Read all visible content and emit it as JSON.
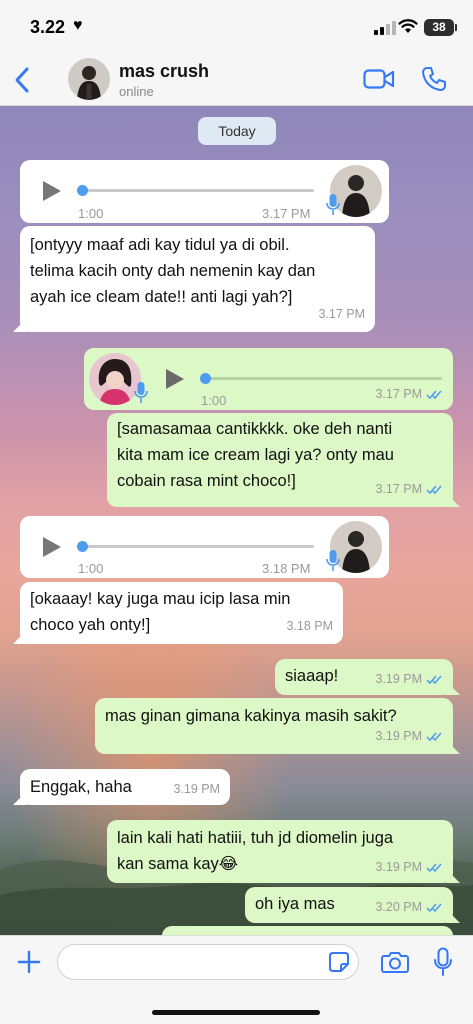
{
  "status_bar": {
    "time": "3.22",
    "battery": "38"
  },
  "header": {
    "contact_name": "mas crush",
    "contact_status": "online"
  },
  "chat": {
    "date_label": "Today",
    "messages": [
      {
        "type": "voice",
        "direction": "in",
        "duration": "1:00",
        "time": "3.17 PM"
      },
      {
        "type": "text",
        "direction": "in",
        "lines": [
          "[ontyyy maaf adi kay tidul ya di obil.",
          "telima kacih onty dah nemenin kay dan",
          "ayah ice cleam date!! anti lagi yah?]"
        ],
        "time": "3.17 PM"
      },
      {
        "type": "voice",
        "direction": "out",
        "duration": "1:00",
        "time": "3.17 PM"
      },
      {
        "type": "text",
        "direction": "out",
        "lines": [
          "[samasamaa cantikkkk. oke deh nanti",
          "kita mam ice cream lagi ya? onty mau",
          "cobain rasa mint choco!]"
        ],
        "time": "3.17 PM"
      },
      {
        "type": "voice",
        "direction": "in",
        "duration": "1:00",
        "time": "3.18 PM"
      },
      {
        "type": "text",
        "direction": "in",
        "lines": [
          "[okaaay! kay juga mau icip lasa min",
          "choco yah onty!]"
        ],
        "time": "3.18 PM"
      },
      {
        "type": "text",
        "direction": "out",
        "lines": [
          "siaaap!"
        ],
        "time": "3.19 PM"
      },
      {
        "type": "text",
        "direction": "out",
        "lines": [
          "mas ginan gimana kakinya masih sakit?"
        ],
        "time": "3.19 PM"
      },
      {
        "type": "text",
        "direction": "in",
        "lines": [
          "Enggak, haha"
        ],
        "time": "3.19 PM"
      },
      {
        "type": "text",
        "direction": "out",
        "lines": [
          "lain kali hati hatiii, tuh jd diomelin juga",
          "kan sama kay😂"
        ],
        "time": "3.19 PM"
      },
      {
        "type": "text",
        "direction": "out",
        "lines": [
          "oh iya mas"
        ],
        "time": "3.20 PM"
      }
    ]
  },
  "input_bar": {
    "placeholder": ""
  },
  "icons": {
    "back": "chevron-left-icon",
    "video": "video-call-icon",
    "phone": "phone-call-icon",
    "plus": "plus-icon",
    "sticker": "sticker-icon",
    "camera": "camera-icon",
    "mic": "microphone-icon"
  },
  "colors": {
    "accent": "#3478f6",
    "incoming_bubble": "#ffffff",
    "outgoing_bubble": "#dcf8c6",
    "read_ticks": "#4d9cf0"
  }
}
